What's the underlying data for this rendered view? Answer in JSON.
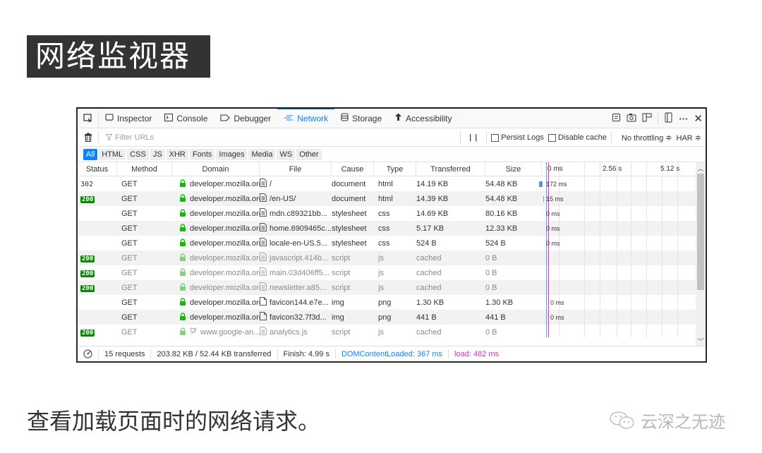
{
  "slide": {
    "title": "网络监视器",
    "caption": "查看加载页面时的网络请求。",
    "watermark": "云深之无迹"
  },
  "toolbar": {
    "tabs": [
      {
        "label": "Inspector",
        "icon": "inspector-icon"
      },
      {
        "label": "Console",
        "icon": "console-icon"
      },
      {
        "label": "Debugger",
        "icon": "debugger-icon"
      },
      {
        "label": "Network",
        "icon": "network-icon",
        "active": true
      },
      {
        "label": "Storage",
        "icon": "storage-icon"
      },
      {
        "label": "Accessibility",
        "icon": "accessibility-icon"
      }
    ],
    "right_icons": [
      "notes-icon",
      "screenshot-icon",
      "frames-icon",
      "responsive-design-icon",
      "more-icon",
      "close-icon"
    ]
  },
  "filterbar": {
    "filter_placeholder": "Filter URLs",
    "pause_label": "| |",
    "persist_logs_label": "Persist Logs",
    "persist_logs_checked": false,
    "disable_cache_label": "Disable cache",
    "disable_cache_checked": false,
    "throttling_label": "No throttling ≑",
    "har_label": "HAR ≑"
  },
  "type_filters": [
    "All",
    "HTML",
    "CSS",
    "JS",
    "XHR",
    "Fonts",
    "Images",
    "Media",
    "WS",
    "Other"
  ],
  "active_type_filter": "All",
  "table": {
    "columns": [
      "Status",
      "Method",
      "Domain",
      "File",
      "Cause",
      "Type",
      "Transferred",
      "Size"
    ],
    "waterfall_ticks": [
      "0 ms",
      "2.56 s",
      "5.12 s"
    ],
    "rows": [
      {
        "status": "302",
        "status_badge": false,
        "method": "GET",
        "domain": "developer.mozilla.org",
        "file": "/",
        "file_icon": "document",
        "cause": "document",
        "type": "html",
        "transferred": "14.19 KB",
        "size": "54.48 KB",
        "timing": "172 ms",
        "dim": false
      },
      {
        "status": "200",
        "status_badge": true,
        "method": "GET",
        "domain": "developer.mozilla.org",
        "file": "/en-US/",
        "file_icon": "document",
        "cause": "document",
        "type": "html",
        "transferred": "14.39 KB",
        "size": "54.48 KB",
        "timing": "15 ms",
        "dim": false
      },
      {
        "status": "",
        "status_badge": false,
        "method": "GET",
        "domain": "developer.mozilla.org",
        "file": "mdn.c89321bb...",
        "file_icon": "document",
        "cause": "stylesheet",
        "type": "css",
        "transferred": "14.69 KB",
        "size": "80.16 KB",
        "timing": "0 ms",
        "dim": false
      },
      {
        "status": "",
        "status_badge": false,
        "method": "GET",
        "domain": "developer.mozilla.org",
        "file": "home.6909465c...",
        "file_icon": "document",
        "cause": "stylesheet",
        "type": "css",
        "transferred": "5.17 KB",
        "size": "12.33 KB",
        "timing": "0 ms",
        "dim": false
      },
      {
        "status": "",
        "status_badge": false,
        "method": "GET",
        "domain": "developer.mozilla.org",
        "file": "locale-en-US.5...",
        "file_icon": "document",
        "cause": "stylesheet",
        "type": "css",
        "transferred": "524 B",
        "size": "524 B",
        "timing": "0 ms",
        "dim": false
      },
      {
        "status": "200",
        "status_badge": true,
        "method": "GET",
        "domain": "developer.mozilla.org",
        "file": "javascript.414b...",
        "file_icon": "document",
        "cause": "script",
        "type": "js",
        "transferred": "cached",
        "size": "0 B",
        "timing": "",
        "dim": true
      },
      {
        "status": "200",
        "status_badge": true,
        "method": "GET",
        "domain": "developer.mozilla.org",
        "file": "main.03d406ff5...",
        "file_icon": "document",
        "cause": "script",
        "type": "js",
        "transferred": "cached",
        "size": "0 B",
        "timing": "",
        "dim": true
      },
      {
        "status": "200",
        "status_badge": true,
        "method": "GET",
        "domain": "developer.mozilla.org",
        "file": "newsletter.a85...",
        "file_icon": "document",
        "cause": "script",
        "type": "js",
        "transferred": "cached",
        "size": "0 B",
        "timing": "",
        "dim": true
      },
      {
        "status": "",
        "status_badge": false,
        "method": "GET",
        "domain": "developer.mozilla.org",
        "file": "favicon144.e7e...",
        "file_icon": "blank-file",
        "cause": "img",
        "type": "png",
        "transferred": "1.30 KB",
        "size": "1.30 KB",
        "timing": "0 ms",
        "dim": false
      },
      {
        "status": "",
        "status_badge": false,
        "method": "GET",
        "domain": "developer.mozilla.org",
        "file": "favicon32.7f3d...",
        "file_icon": "blank-file",
        "cause": "img",
        "type": "png",
        "transferred": "441 B",
        "size": "441 B",
        "timing": "0 ms",
        "dim": false
      },
      {
        "status": "200",
        "status_badge": true,
        "method": "GET",
        "domain": "www.google-an...",
        "file": "analytics.js",
        "file_icon": "document",
        "cause": "script",
        "type": "js",
        "transferred": "cached",
        "size": "0 B",
        "timing": "",
        "dim": true,
        "tracker": true
      }
    ]
  },
  "statusbar": {
    "requests": "15 requests",
    "transferred": "203.82 KB / 52.44 KB transferred",
    "finish": "Finish: 4.99 s",
    "dom_content_loaded": "DOMContentLoaded: 367 ms",
    "load": "load: 482 ms"
  },
  "colors": {
    "accent": "#0a84ff",
    "status_ok": "#058b00",
    "lock": "#12bc00",
    "dcl_line": "#5b9be6",
    "load_line": "#d92bc6"
  }
}
